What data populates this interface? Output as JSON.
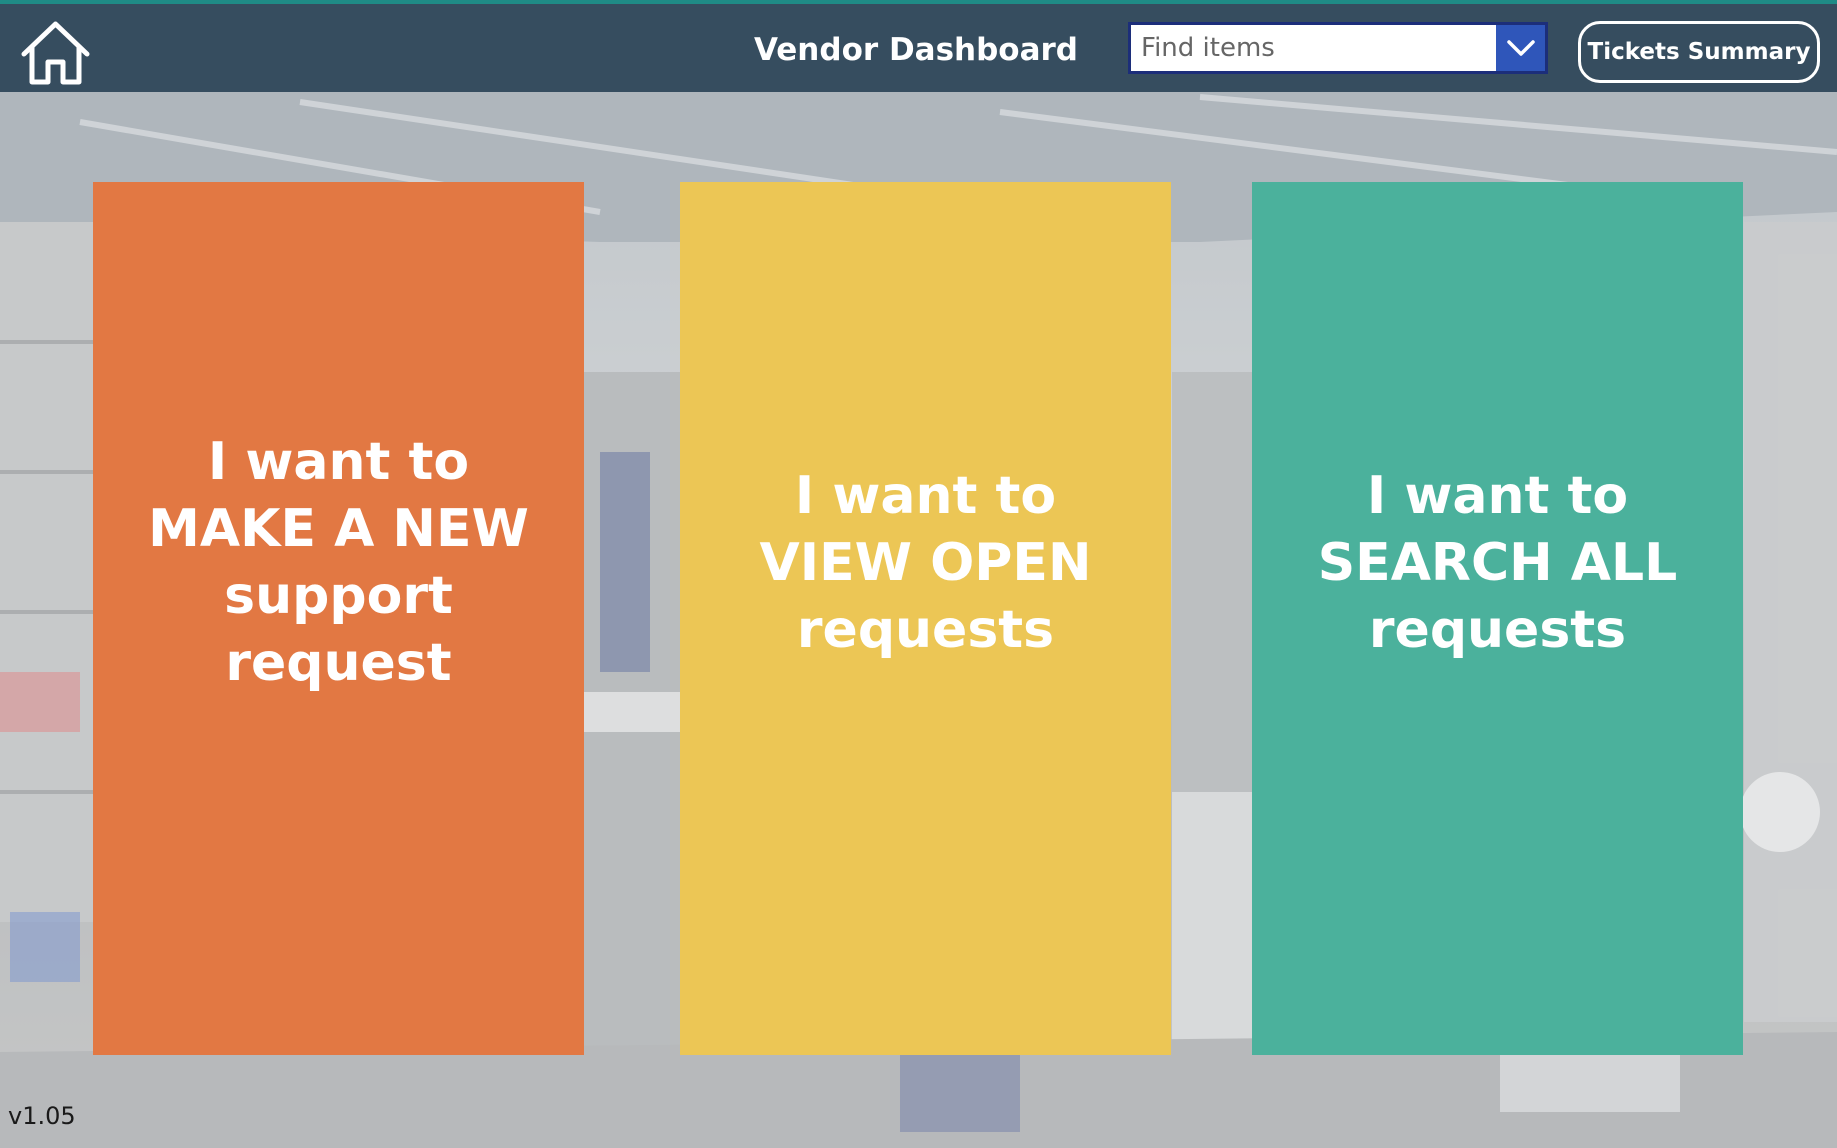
{
  "header": {
    "title": "Vendor Dashboard",
    "home_icon": "home-icon",
    "search": {
      "placeholder": "Find items",
      "value": "",
      "dropdown_icon": "chevron-down-icon"
    },
    "tickets_summary_label": "Tickets Summary"
  },
  "tiles": [
    {
      "line1": "I want to",
      "line2": "MAKE A NEW",
      "line3": "support",
      "line4": "request",
      "color": "#e27843"
    },
    {
      "line1": "I want to",
      "line2": "VIEW OPEN",
      "line3": "requests",
      "color": "#ecc655"
    },
    {
      "line1": "I want to",
      "line2": "SEARCH ALL",
      "line3": "requests",
      "color": "#4bb19c"
    }
  ],
  "version": "v1.05",
  "colors": {
    "header_bg": "#364d5f",
    "header_accent": "#1f8b86",
    "dropdown_bg": "#2f56ba",
    "text_light": "#ffffff"
  }
}
